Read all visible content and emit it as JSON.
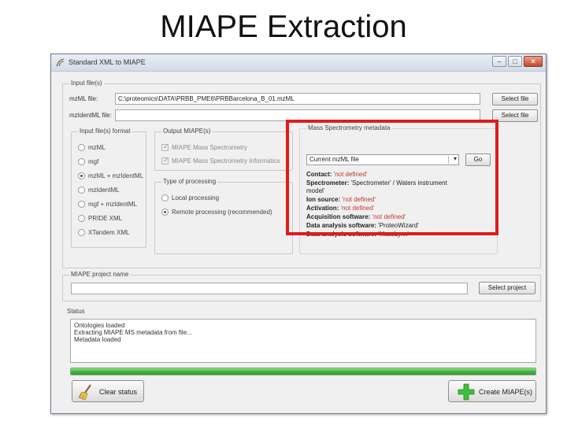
{
  "slide": {
    "title": "MIAPE Extraction"
  },
  "window": {
    "title": "Standard XML to MIAPE",
    "controls": {
      "minimize": "–",
      "maximize": "□",
      "close": "✕"
    }
  },
  "input_files": {
    "group_label": "Input file(s)",
    "mzml_label": "mzML file:",
    "mzml_value": "C:\\proteomics\\DATA\\PRBB_PME6\\PRBBarcelona_B_01.mzML",
    "mzident_label": "mzIdentML file:",
    "mzident_value": "",
    "select_button": "Select file"
  },
  "format": {
    "group_label": "Input file(s) format",
    "options": [
      "mzML",
      "mgf",
      "mzML + mzIdentML",
      "mzIdentML",
      "mgf + mzIdentML",
      "PRIDE XML",
      "XTandem XML"
    ],
    "selected_index": 2
  },
  "output": {
    "group_label": "Output MIAPE(s)",
    "options": [
      "MIAPE Mass Spectrometry",
      "MIAPE Mass Spectrometry Informatics"
    ]
  },
  "processing": {
    "group_label": "Type of processing",
    "options": [
      "Local processing",
      "Remote processing (recommended)"
    ],
    "selected_index": 1
  },
  "ms_metadata": {
    "group_label": "Mass Spectrometry metadata",
    "select_value": "Current mzML file",
    "go_button": "Go",
    "lines": [
      {
        "key": "Contact:",
        "value": " 'not defined'",
        "value_color": "red"
      },
      {
        "key": "Spectrometer:",
        "value": " 'Spectrometer' / Waters instrument",
        "value_color": "normal"
      },
      {
        "key": "",
        "value": "model'",
        "value_color": "normal"
      },
      {
        "key": "Ion source:",
        "value": " 'not defined'",
        "value_color": "red"
      },
      {
        "key": "Activation:",
        "value": " 'not defined'",
        "value_color": "red"
      },
      {
        "key": "Acquisition software:",
        "value": " 'not defined'",
        "value_color": "red"
      },
      {
        "key": "Data analysis software:",
        "value": " 'ProteoWizard'",
        "value_color": "normal"
      },
      {
        "key": "Data analysis software:",
        "value": " 'MassLynx'",
        "value_color": "normal"
      }
    ]
  },
  "project": {
    "group_label": "MIAPE project name",
    "value": "",
    "select_button": "Select project"
  },
  "status": {
    "group_label": "Status",
    "lines": [
      "Ontologies loaded",
      "Extracting MIAPE MS metadata from file...",
      "Metadata loaded"
    ],
    "progress_percent": 100
  },
  "actions": {
    "clear_label": "Clear status",
    "create_label": "Create MIAPE(s)"
  },
  "colors": {
    "highlight": "#e21b1b",
    "progress": "#3cb53a",
    "red_value": "#c0392b"
  }
}
